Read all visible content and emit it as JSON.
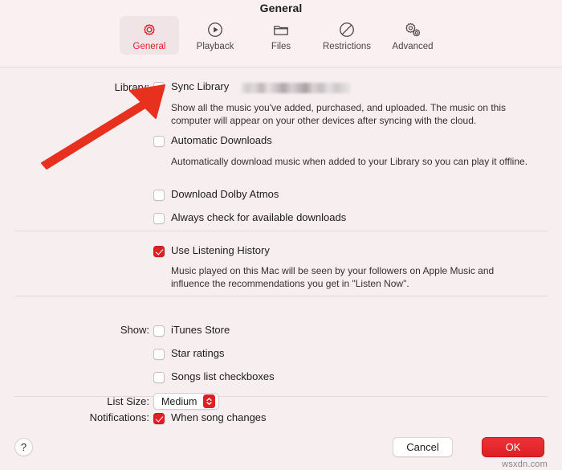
{
  "window": {
    "title": "General"
  },
  "toolbar": {
    "tabs": [
      {
        "label": "General",
        "icon": "gear-icon",
        "selected": true
      },
      {
        "label": "Playback",
        "icon": "play-circle-icon",
        "selected": false
      },
      {
        "label": "Files",
        "icon": "folder-icon",
        "selected": false
      },
      {
        "label": "Restrictions",
        "icon": "no-entry-icon",
        "selected": false
      },
      {
        "label": "Advanced",
        "icon": "gears-icon",
        "selected": false
      }
    ]
  },
  "sections": {
    "library": {
      "label": "Library:",
      "sync_library": {
        "label": "Sync Library",
        "checked": false,
        "redacted_value": ""
      },
      "sync_library_desc": "Show all the music you've added, purchased, and uploaded. The music on this computer will appear on your other devices after syncing with the cloud.",
      "automatic_downloads": {
        "label": "Automatic Downloads",
        "checked": false
      },
      "automatic_downloads_desc": "Automatically download music when added to your Library so you can play it offline.",
      "download_dolby_atmos": {
        "label": "Download Dolby Atmos",
        "checked": false
      },
      "always_check_downloads": {
        "label": "Always check for available downloads",
        "checked": false
      }
    },
    "listening_history": {
      "use_listening_history": {
        "label": "Use Listening History",
        "checked": true
      },
      "desc": "Music played on this Mac will be seen by your followers on Apple Music and influence the recommendations you get in \"Listen Now\"."
    },
    "show": {
      "label": "Show:",
      "items": [
        {
          "label": "iTunes Store",
          "checked": false
        },
        {
          "label": "Star ratings",
          "checked": false
        },
        {
          "label": "Songs list checkboxes",
          "checked": false
        }
      ]
    },
    "list_size": {
      "label": "List Size:",
      "value": "Medium"
    },
    "notifications": {
      "label": "Notifications:",
      "when_song_changes": {
        "label": "When song changes",
        "checked": true
      }
    }
  },
  "footer": {
    "help_label": "?",
    "cancel_label": "Cancel",
    "ok_label": "OK"
  },
  "watermark": "wsxdn.com",
  "colors": {
    "accent_red": "#dd2025",
    "window_bg": "#f7eef0",
    "toolbar_bg": "#faf0f2",
    "annotation_arrow": "#e8301f"
  }
}
